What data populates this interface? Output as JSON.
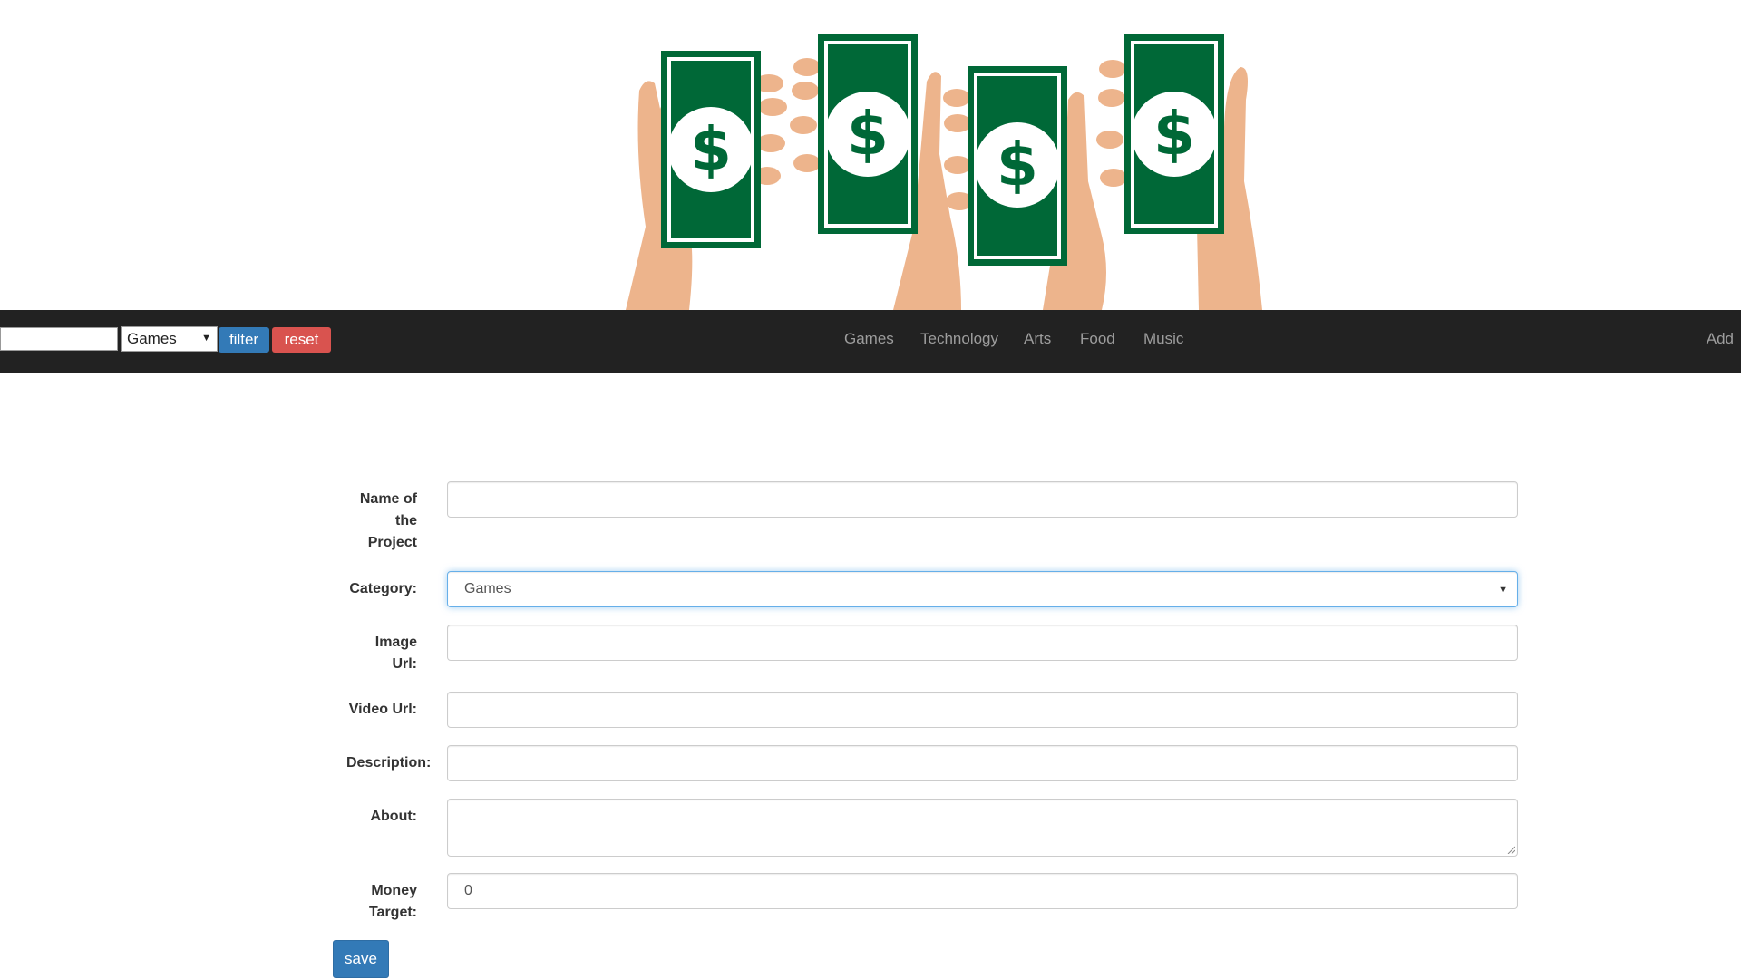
{
  "hero": {
    "image": "money-hands-illustration",
    "colors": {
      "bill": "#006837",
      "bill_inner": "#ffffff",
      "hand": "#EDB48C",
      "hand_shadow": "#E5A47A"
    }
  },
  "navbar": {
    "search_value": "",
    "category_select": {
      "selected": "Games"
    },
    "filter_label": "filter",
    "reset_label": "reset",
    "links": [
      {
        "label": "Games"
      },
      {
        "label": "Technology"
      },
      {
        "label": "Arts"
      },
      {
        "label": "Food"
      },
      {
        "label": "Music"
      }
    ],
    "add_label": "Add",
    "colors": {
      "background": "#222222",
      "link": "#9d9d9d",
      "filter": "#337ab7",
      "reset": "#d9534f"
    }
  },
  "form": {
    "name": {
      "label": "Name of the Project",
      "label_lines": [
        "Name of",
        "the",
        "Project"
      ],
      "value": ""
    },
    "category": {
      "label": "Category:",
      "selected": "Games"
    },
    "image_url": {
      "label": "Image Url:",
      "label_lines": [
        "Image",
        "Url:"
      ],
      "value": ""
    },
    "video_url": {
      "label": "Video Url:",
      "value": ""
    },
    "description": {
      "label": "Description:",
      "value": ""
    },
    "about": {
      "label": "About:",
      "value": ""
    },
    "money_target": {
      "label": "Money Target:",
      "label_lines": [
        "Money",
        "Target:"
      ],
      "value": "0"
    },
    "save_label": "save"
  }
}
